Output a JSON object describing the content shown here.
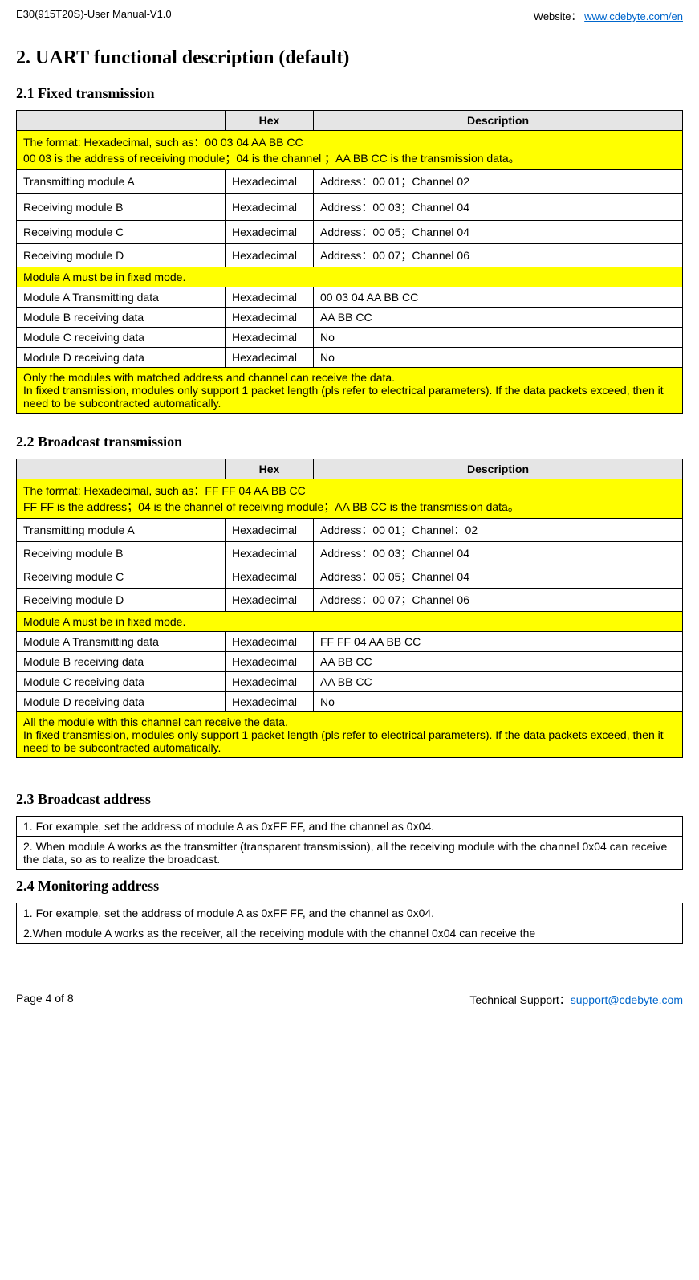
{
  "header": {
    "left": "E30(915T20S)-User Manual-V1.0",
    "rightLabel": "Website：",
    "rightLink": "www.cdebyte.com/en"
  },
  "title": "2.  UART functional description (default)",
  "section21": {
    "heading": "2.1 Fixed transmission",
    "colHex": "Hex",
    "colDesc": "Description",
    "note1a": "The format: Hexadecimal, such as：00 03 04 AA BB CC",
    "note1b": "00 03 is the address of receiving module；04 is the channel  ；AA BB CC is the transmission data。",
    "r1c1": "Transmitting module A",
    "r1c2": "Hexadecimal",
    "r1c3": "Address：00 01；Channel 02",
    "r2c1": "Receiving module B",
    "r2c2": "Hexadecimal",
    "r2c3": "Address：00 03；Channel 04",
    "r3c1": "Receiving module C",
    "r3c2": "Hexadecimal",
    "r3c3": "Address：00 05；Channel 04",
    "r4c1": "Receiving module D",
    "r4c2": "Hexadecimal",
    "r4c3": "Address：00 07；Channel 06",
    "note2": "Module A must be in fixed mode.",
    "r5c1": "Module A Transmitting data",
    "r5c2": "Hexadecimal",
    "r5c3": "00 03 04 AA BB CC",
    "r6c1": "Module B receiving data",
    "r6c2": "Hexadecimal",
    "r6c3": "AA BB CC",
    "r7c1": "Module C receiving data",
    "r7c2": "Hexadecimal",
    "r7c3": "No",
    "r8c1": "Module D receiving data",
    "r8c2": "Hexadecimal",
    "r8c3": "No",
    "note3a": "Only the modules with matched address and channel can receive the data.",
    "note3b": "In fixed transmission, modules only support 1 packet length (pls refer to electrical parameters). If the data packets exceed, then it need to be subcontracted automatically."
  },
  "section22": {
    "heading": "2.2 Broadcast transmission",
    "colHex": "Hex",
    "colDesc": "Description",
    "note1a": "The format: Hexadecimal, such as：FF FF 04 AA BB CC",
    "note1b": "FF FF is the address；04 is the channel of receiving module；AA BB CC is the transmission data。",
    "r1c1": "Transmitting module A",
    "r1c2": "Hexadecimal",
    "r1c3": "Address：00 01；Channel：02",
    "r2c1": "Receiving module B",
    "r2c2": "Hexadecimal",
    "r2c3": "Address：00 03；Channel 04",
    "r3c1": "Receiving module C",
    "r3c2": "Hexadecimal",
    "r3c3": "Address：00 05；Channel 04",
    "r4c1": "Receiving module D",
    "r4c2": "Hexadecimal",
    "r4c3": "Address：00 07；Channel 06",
    "note2": "Module A must be in fixed mode.",
    "r5c1": "Module A Transmitting data",
    "r5c2": "Hexadecimal",
    "r5c3": "FF FF 04 AA BB CC",
    "r6c1": "Module B receiving data",
    "r6c2": "Hexadecimal",
    "r6c3": "AA BB CC",
    "r7c1": "Module C receiving data",
    "r7c2": "Hexadecimal",
    "r7c3": "AA BB CC",
    "r8c1": "Module D receiving data",
    "r8c2": "Hexadecimal",
    "r8c3": "No",
    "note3a": "All the module with this channel can receive the data.",
    "note3b": "In fixed transmission, modules only support 1 packet length (pls refer to electrical parameters). If the data packets exceed, then it need to be subcontracted automatically."
  },
  "section23": {
    "heading": "2.3 Broadcast address",
    "r1": "1. For example, set the address of module A as 0xFF FF, and the channel as 0x04.",
    "r2": "2. When module A works as the transmitter (transparent transmission), all the receiving module with the channel 0x04 can receive the data, so as to realize the broadcast."
  },
  "section24": {
    "heading": "2.4 Monitoring address",
    "r1": "1. For example, set the address of module A as 0xFF FF, and the channel as 0x04.",
    "r2": "2.When module A works as the receiver, all the receiving module with the channel 0x04 can receive the"
  },
  "footer": {
    "left": "Page   4   of   8",
    "rightLabel": "Technical Support：",
    "rightLink": "support@cdebyte.com"
  }
}
